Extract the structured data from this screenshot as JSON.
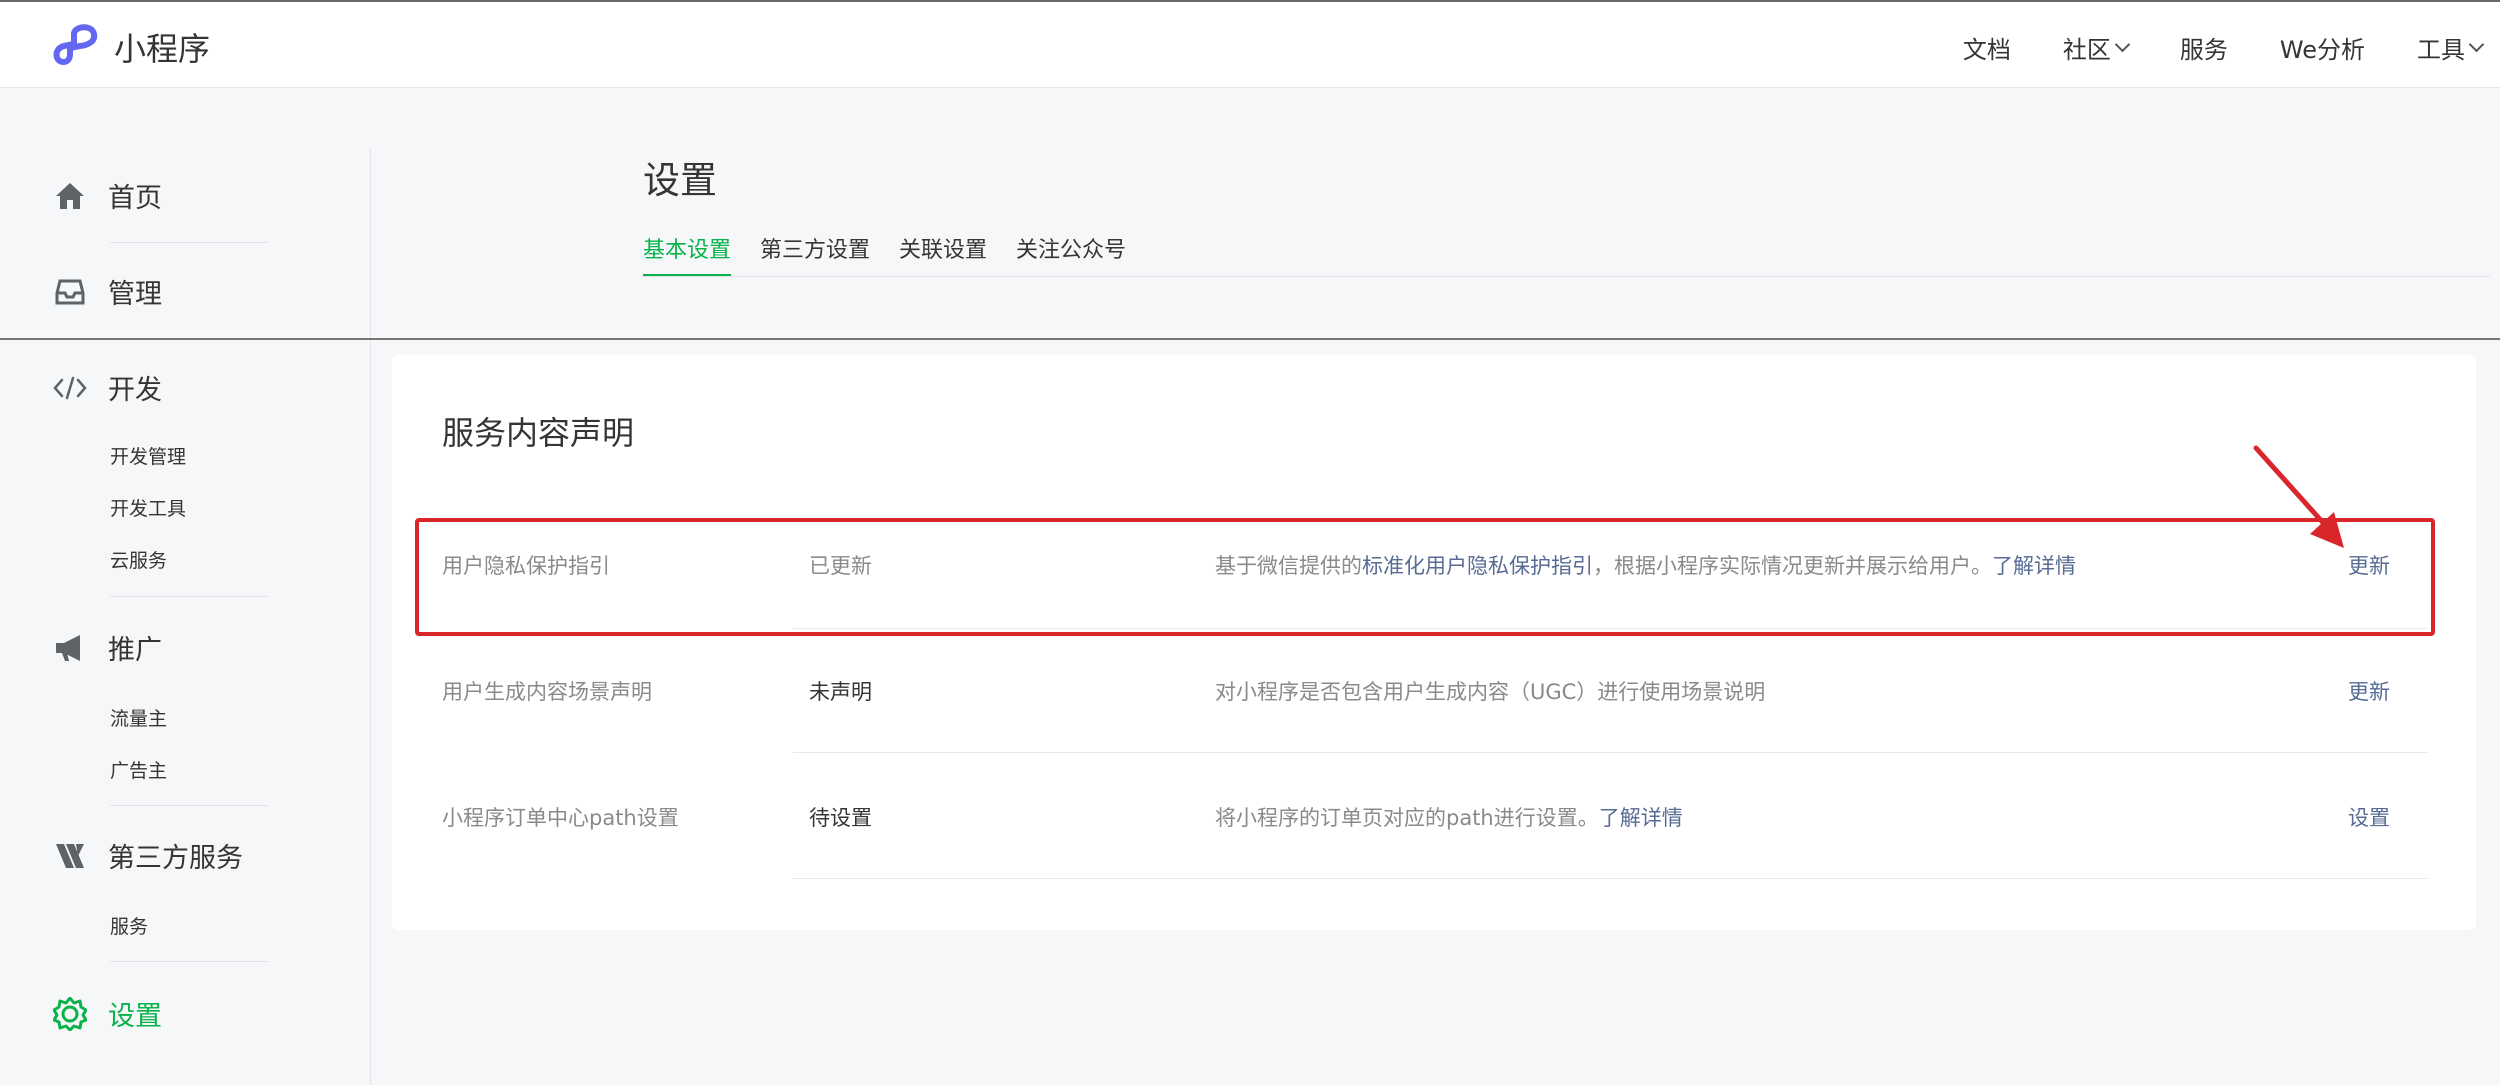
{
  "header": {
    "brand": "小程序",
    "nav": [
      {
        "label": "文档",
        "dropdown": false
      },
      {
        "label": "社区",
        "dropdown": true
      },
      {
        "label": "服务",
        "dropdown": false
      },
      {
        "label": "We分析",
        "dropdown": false
      },
      {
        "label": "工具",
        "dropdown": true
      }
    ]
  },
  "sidebar": {
    "home": "首页",
    "manage": "管理",
    "dev": {
      "label": "开发",
      "items": [
        "开发管理",
        "开发工具",
        "云服务"
      ]
    },
    "promote": {
      "label": "推广",
      "items": [
        "流量主",
        "广告主"
      ]
    },
    "third_party": {
      "label": "第三方服务",
      "items": [
        "服务"
      ]
    },
    "settings": "设置"
  },
  "main": {
    "title": "设置",
    "tabs": [
      "基本设置",
      "第三方设置",
      "关联设置",
      "关注公众号"
    ],
    "active_tab": 0,
    "section_title": "服务内容声明",
    "rows": [
      {
        "name": "用户隐私保护指引",
        "status": "已更新",
        "desc_prefix": "基于微信提供的",
        "desc_link": "标准化用户隐私保护指引",
        "desc_middle": "，根据小程序实际情况更新并展示给用户。",
        "desc_link2": "了解详情",
        "action": "更新"
      },
      {
        "name": "用户生成内容场景声明",
        "status": "未声明",
        "desc_prefix": "对小程序是否包含用户生成内容（UGC）进行使用场景说明",
        "action": "更新"
      },
      {
        "name": "小程序订单中心path设置",
        "status": "待设置",
        "desc_prefix": "将小程序的订单页对应的path进行设置。",
        "desc_link2": "了解详情",
        "action": "设置"
      }
    ]
  },
  "colors": {
    "accent": "#07b34a",
    "link": "#576b95",
    "highlight": "#d8262b",
    "logo": "#6467f0"
  }
}
